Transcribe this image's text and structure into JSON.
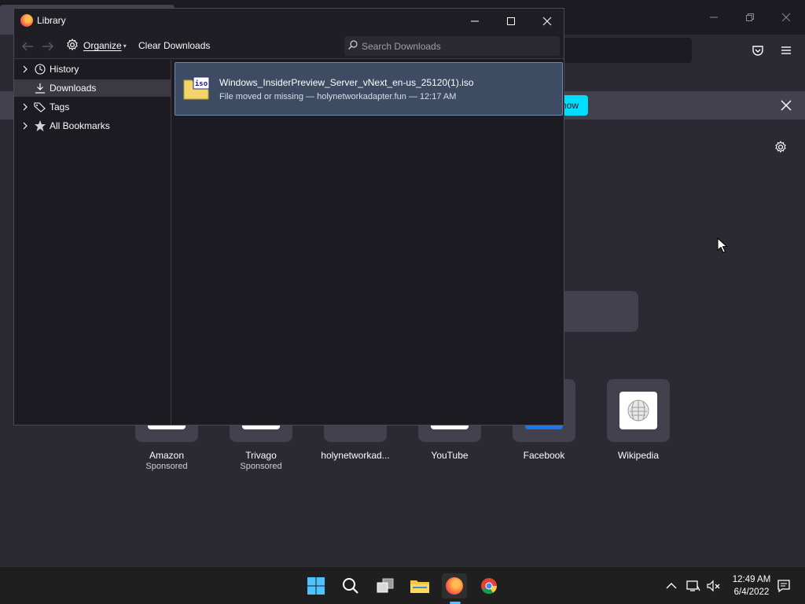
{
  "background_window": {
    "notice_button_label": "now",
    "tiles": [
      {
        "label": "Amazon",
        "sub": "Sponsored"
      },
      {
        "label": "Trivago",
        "sub": "Sponsored"
      },
      {
        "label": "holynetworkad...",
        "sub": ""
      },
      {
        "label": "YouTube",
        "sub": ""
      },
      {
        "label": "Facebook",
        "sub": ""
      },
      {
        "label": "Wikipedia",
        "sub": ""
      }
    ]
  },
  "library": {
    "title": "Library",
    "toolbar": {
      "organize_label": "Organize",
      "clear_label": "Clear Downloads",
      "search_placeholder": "Search Downloads"
    },
    "sidebar": {
      "items": [
        {
          "label": "History",
          "icon": "clock-icon",
          "expandable": true,
          "selected": false
        },
        {
          "label": "Downloads",
          "icon": "download-icon",
          "expandable": false,
          "selected": true
        },
        {
          "label": "Tags",
          "icon": "tag-icon",
          "expandable": true,
          "selected": false
        },
        {
          "label": "All Bookmarks",
          "icon": "star-icon",
          "expandable": true,
          "selected": false
        }
      ]
    },
    "downloads": [
      {
        "filename": "Windows_InsiderPreview_Server_vNext_en-us_25120(1).iso",
        "status": "File moved or missing — holynetworkadapter.fun — 12:17 AM",
        "icon_text": "iso"
      }
    ]
  },
  "taskbar": {
    "time": "12:49 AM",
    "date": "6/4/2022"
  },
  "colors": {
    "selection": "#3d4b63",
    "accent": "#00ddff",
    "taskbar_indicator": "#4cc2ff"
  }
}
